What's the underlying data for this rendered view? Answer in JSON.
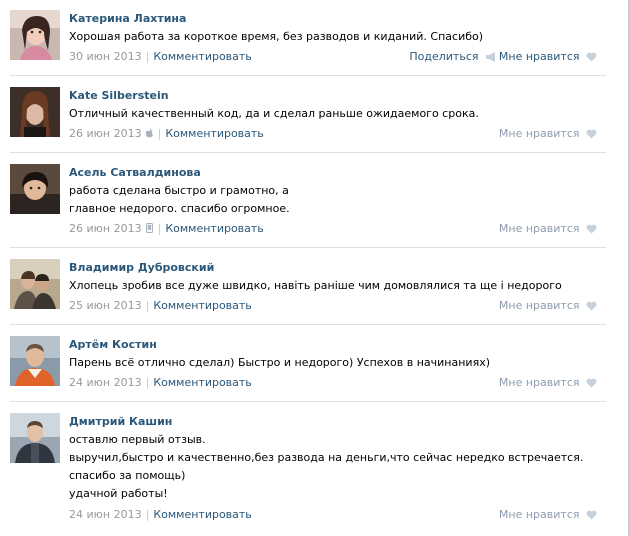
{
  "comments": [
    {
      "author": "Катерина Лахтина",
      "lines": [
        "Хорошая работа за короткое время, без разводов и киданий. Спасибо)"
      ],
      "date": "30 июн 2013",
      "device_icon": "",
      "comment_label": "Комментировать",
      "share_label": "Поделиться",
      "like_label": "Мне нравится",
      "like_state": "active"
    },
    {
      "author": "Kate Silberstein",
      "lines": [
        "Отличный качественный код, да и сделал раньше ожидаемого срока."
      ],
      "date": "26 июн 2013",
      "device_icon": "apple-icon",
      "comment_label": "Комментировать",
      "like_label": "Мне нравится",
      "like_state": "idle"
    },
    {
      "author": "Асель Сатвалдинова",
      "lines": [
        "работа сделана быстро и грамотно, а",
        "главное недорого. спасибо огромное."
      ],
      "date": "26 июн 2013",
      "device_icon": "mobile-icon",
      "comment_label": "Комментировать",
      "like_label": "Мне нравится",
      "like_state": "idle"
    },
    {
      "author": "Владимир Дубровский",
      "lines": [
        "Хлопець зробив все дуже швидко, навіть раніше чим домовлялися та ще і недорого"
      ],
      "date": "25 июн 2013",
      "device_icon": "",
      "comment_label": "Комментировать",
      "like_label": "Мне нравится",
      "like_state": "idle"
    },
    {
      "author": "Артём Костин",
      "lines": [
        "Парень всё отлично сделал) Быстро и недорого) Успехов в начинаниях)"
      ],
      "date": "24 июн 2013",
      "device_icon": "",
      "comment_label": "Комментировать",
      "like_label": "Мне нравится",
      "like_state": "idle"
    },
    {
      "author": "Дмитрий Кашин",
      "lines": [
        "оставлю первый отзыв.",
        "выручил,быстро и качественно,без развода на деньги,что сейчас нередко встречается.",
        "спасибо за помощь)",
        "удачной работы!"
      ],
      "date": "24 июн 2013",
      "device_icon": "",
      "comment_label": "Комментировать",
      "like_label": "Мне нравится",
      "like_state": "idle"
    }
  ],
  "colors": {
    "link": "#2b587a",
    "meta": "#999999",
    "like_idle": "#8e9cae",
    "divider": "#dae1e8"
  },
  "icons": {
    "share": "megaphone-icon",
    "like": "heart-icon",
    "apple": "apple-icon",
    "mobile": "mobile-icon"
  }
}
